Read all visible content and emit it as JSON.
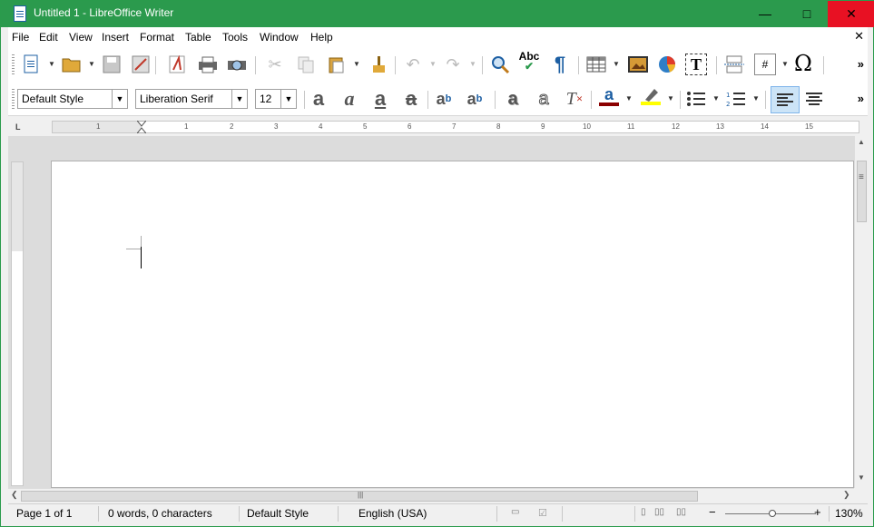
{
  "window": {
    "title": "Untitled 1 - LibreOffice Writer",
    "minimize_glyph": "—",
    "maximize_glyph": "□",
    "close_glyph": "✕"
  },
  "menu": {
    "items": [
      "File",
      "Edit",
      "View",
      "Insert",
      "Format",
      "Table",
      "Tools",
      "Window",
      "Help"
    ],
    "close_glyph": "✕"
  },
  "toolbar_standard": {
    "icons": [
      "new-document-icon",
      "open-folder-icon",
      "save-icon",
      "export-pdf-icon-disabled",
      "export-pdf-icon",
      "print-icon",
      "print-preview-icon",
      "cut-icon",
      "copy-icon",
      "paste-icon",
      "clone-formatting-icon",
      "undo-icon",
      "redo-icon",
      "find-replace-icon",
      "spelling-icon",
      "formatting-marks-icon",
      "insert-table-icon",
      "insert-image-icon",
      "insert-chart-icon",
      "insert-textbox-icon",
      "page-break-icon",
      "insert-field-icon",
      "special-character-icon"
    ],
    "spelling_text": "Abc",
    "pilcrow": "¶",
    "omega": "Ω",
    "more": "»"
  },
  "toolbar_formatting": {
    "paragraph_style": "Default Style",
    "font_name": "Liberation Serif",
    "font_size": "12",
    "more": "»",
    "letter_a": "a",
    "colors": {
      "font_color": "#8b0000",
      "highlight": "#ffff00",
      "accent": "#2b9a4d"
    }
  },
  "ruler": {
    "corner": "L",
    "numbers": [
      "1",
      "1",
      "2",
      "3",
      "4",
      "5",
      "6",
      "7",
      "8",
      "9",
      "10",
      "11",
      "12",
      "13",
      "14",
      "15"
    ]
  },
  "scrollbars": {
    "up": "▲",
    "down": "▼",
    "left": "❮",
    "right": "❯",
    "grip": "≡",
    "hgrip": "|||"
  },
  "status": {
    "page": "Page 1 of 1",
    "words": "0 words, 0 characters",
    "style": "Default Style",
    "language": "English (USA)",
    "zoom_minus": "−",
    "zoom_plus": "+",
    "zoom": "130%"
  }
}
